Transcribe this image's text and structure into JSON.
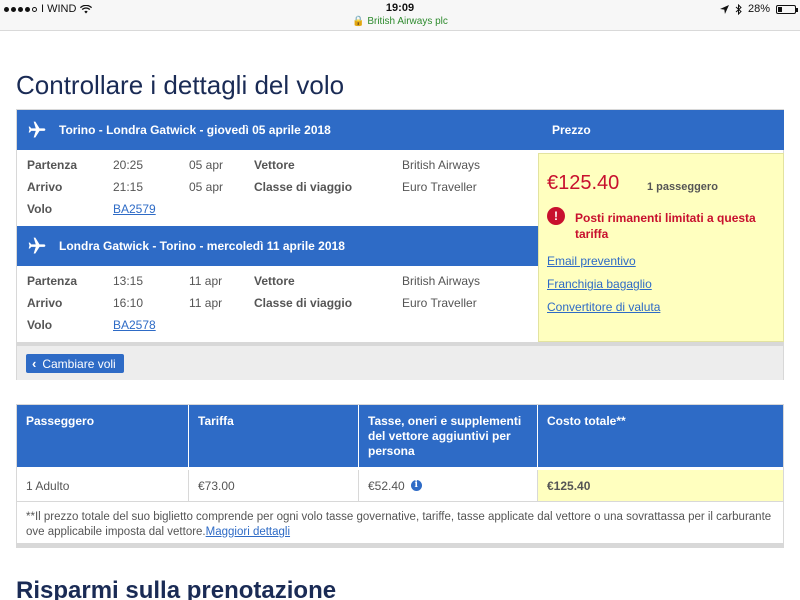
{
  "statusbar": {
    "carrier": "I WIND",
    "time": "19:09",
    "site": "British Airways plc",
    "battery": "28%",
    "battery_level": 0.28
  },
  "page": {
    "cut_heading": "Prezzo",
    "title": "Controllare i dettagli del volo",
    "bottom_heading": "Risparmi sulla prenotazione"
  },
  "labels": {
    "departure": "Partenza",
    "arrival": "Arrivo",
    "flight": "Volo",
    "carrier": "Vettore",
    "class": "Classe di viaggio"
  },
  "segments": [
    {
      "header": "Torino - Londra Gatwick - giovedì 05 aprile 2018",
      "dep_time": "20:25",
      "dep_date": "05 apr",
      "arr_time": "21:15",
      "arr_date": "05 apr",
      "carrier": "British Airways",
      "class": "Euro Traveller",
      "flight": "BA2579"
    },
    {
      "header": "Londra Gatwick - Torino - mercoledì 11 aprile 2018",
      "dep_time": "13:15",
      "dep_date": "11 apr",
      "arr_time": "16:10",
      "arr_date": "11 apr",
      "carrier": "British Airways",
      "class": "Euro Traveller",
      "flight": "BA2578"
    }
  ],
  "price_panel": {
    "header": "Prezzo",
    "amount": "€125.40",
    "passengers": "1 passeggero",
    "warning": "Posti rimanenti limitati a questa tariffa",
    "links": [
      "Email preventivo",
      "Franchigia bagaglio",
      "Convertitore di valuta"
    ]
  },
  "change_flights": "Cambiare voli",
  "fare_table": {
    "headers": [
      "Passeggero",
      "Tariffa",
      "Tasse, oneri e supplementi del vettore aggiuntivi per persona",
      "Costo totale**"
    ],
    "row": [
      "1 Adulto",
      "€73.00",
      "€52.40",
      "€125.40"
    ],
    "note": "**Il prezzo totale del suo biglietto comprende per ogni volo tasse governative, tariffe, tasse applicate dal vettore o una sovrattassa per il carburante ove applicabile imposta dal vettore.",
    "note_link": "Maggiori dettagli"
  }
}
